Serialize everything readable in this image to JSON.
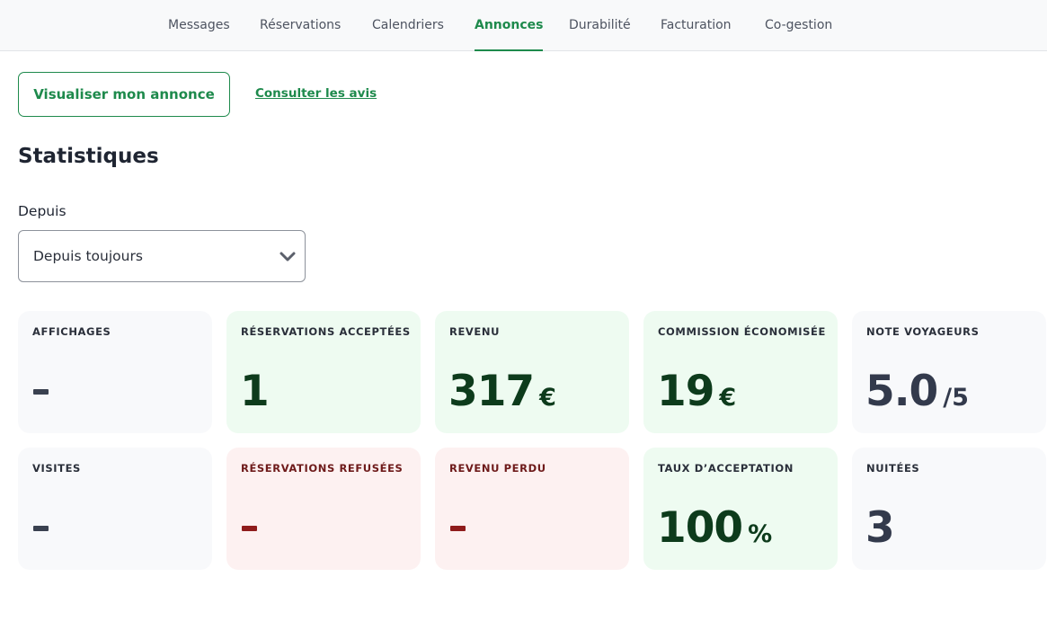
{
  "nav": {
    "tabs": [
      {
        "label": "Messages",
        "active": false
      },
      {
        "label": "Réservations",
        "active": false
      },
      {
        "label": "Calendriers",
        "active": false
      },
      {
        "label": "Annonces",
        "active": true
      },
      {
        "label": "Durabilité",
        "active": false
      },
      {
        "label": "Facturation",
        "active": false
      },
      {
        "label": "Co-gestion",
        "active": false
      }
    ]
  },
  "actions": {
    "view_listing": "Visualiser mon annonce",
    "view_reviews": "Consulter les avis"
  },
  "stats": {
    "title": "Statistiques",
    "period_label": "Depuis",
    "period_value": "Depuis toujours"
  },
  "cards": [
    {
      "label": "AFFICHAGES",
      "value": "-",
      "unit": "",
      "tone": "neutral"
    },
    {
      "label": "RÉSERVATIONS ACCEPTÉES",
      "value": "1",
      "unit": "",
      "tone": "green"
    },
    {
      "label": "REVENU",
      "value": "317",
      "unit": "€",
      "tone": "green"
    },
    {
      "label": "COMMISSION ÉCONOMISÉE",
      "value": "19",
      "unit": "€",
      "tone": "green"
    },
    {
      "label": "NOTE VOYAGEURS",
      "value": "5.0",
      "unit": "/5",
      "tone": "neutral"
    },
    {
      "label": "VISITES",
      "value": "-",
      "unit": "",
      "tone": "neutral"
    },
    {
      "label": "RÉSERVATIONS REFUSÉES",
      "value": "-",
      "unit": "",
      "tone": "red"
    },
    {
      "label": "REVENU PERDU",
      "value": "-",
      "unit": "",
      "tone": "red"
    },
    {
      "label": "TAUX D’ACCEPTATION",
      "value": "100",
      "unit": "%",
      "tone": "green"
    },
    {
      "label": "NUITÉES",
      "value": "3",
      "unit": "",
      "tone": "neutral"
    }
  ],
  "colors": {
    "accent": "#1e8a4c",
    "green_card": "#eefbf1",
    "red_card": "#fdf1f1",
    "neutral_card": "#f8f9fb"
  },
  "icons": {
    "select_arrow": "chevron-down-icon"
  }
}
